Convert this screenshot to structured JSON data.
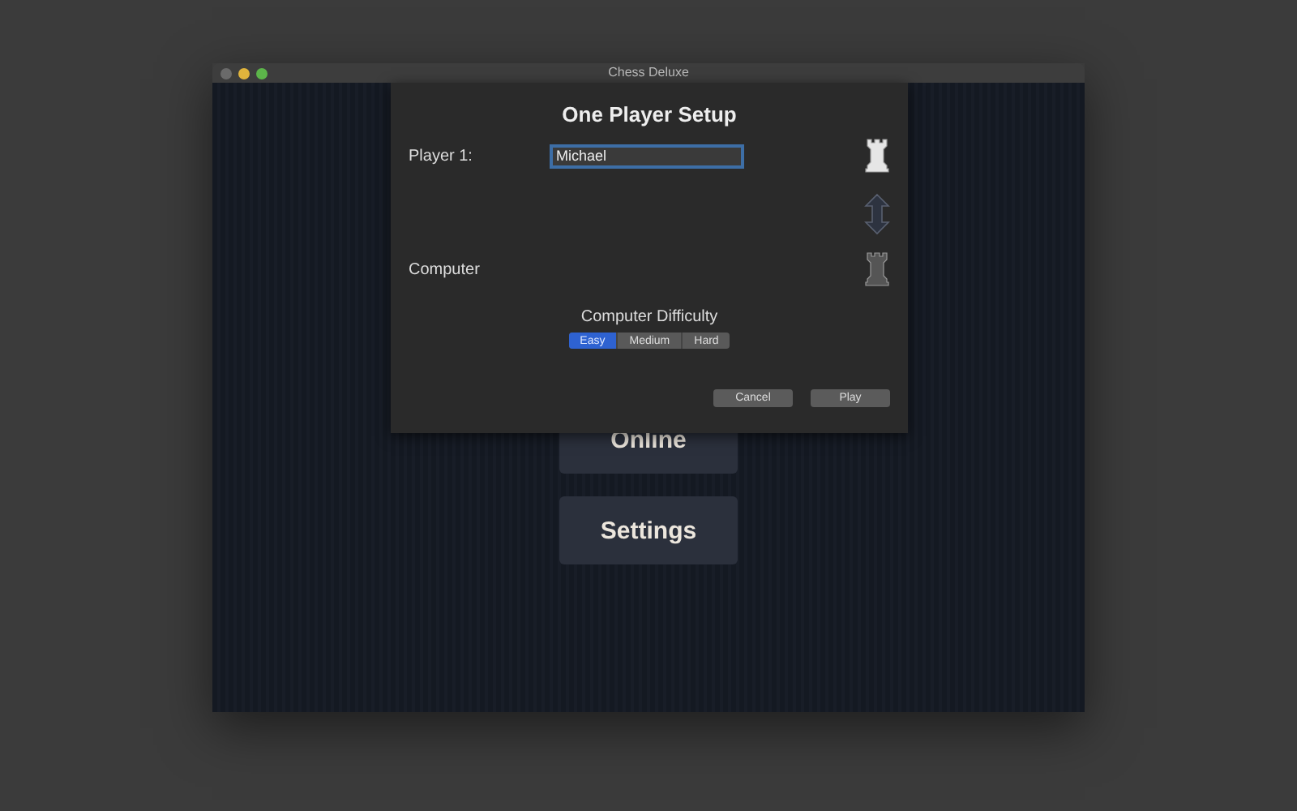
{
  "window": {
    "title": "Chess Deluxe"
  },
  "menu": [
    {
      "label": "Online"
    },
    {
      "label": "Settings"
    }
  ],
  "sheet": {
    "title": "One Player Setup",
    "players": [
      {
        "label": "Player 1:",
        "value": "Michael",
        "color": "#e6e6e6"
      },
      {
        "label": "Computer",
        "color": "#555555"
      }
    ],
    "difficulty": {
      "label": "Computer Difficulty",
      "options": [
        {
          "label": "Easy",
          "selected": true
        },
        {
          "label": "Medium",
          "selected": false
        },
        {
          "label": "Hard",
          "selected": false
        }
      ]
    },
    "buttons": [
      {
        "label": "Cancel"
      },
      {
        "label": "Play"
      }
    ]
  }
}
